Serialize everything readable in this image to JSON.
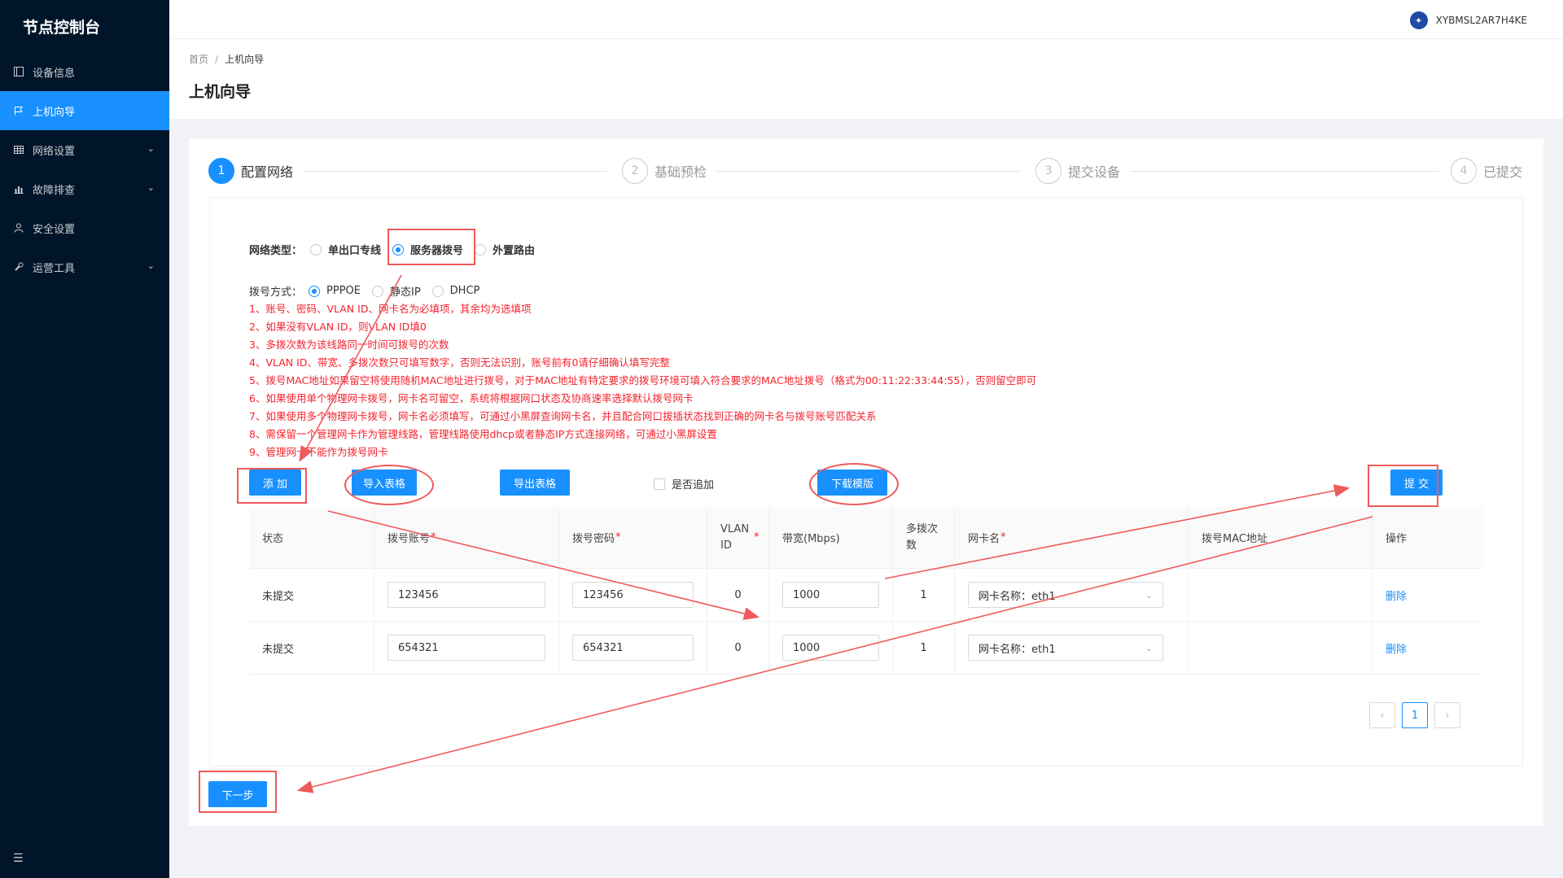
{
  "app": {
    "title": "节点控制台"
  },
  "sidebar": {
    "items": [
      {
        "label": "设备信息",
        "icon": "device-icon",
        "active": false,
        "expandable": false
      },
      {
        "label": "上机向导",
        "icon": "flag-icon",
        "active": true,
        "expandable": false
      },
      {
        "label": "网络设置",
        "icon": "grid-icon",
        "active": false,
        "expandable": true
      },
      {
        "label": "故障排查",
        "icon": "chart-icon",
        "active": false,
        "expandable": true
      },
      {
        "label": "安全设置",
        "icon": "user-icon",
        "active": false,
        "expandable": false
      },
      {
        "label": "运营工具",
        "icon": "tool-icon",
        "active": false,
        "expandable": true
      }
    ]
  },
  "header": {
    "username": "XYBMSL2AR7H4KE"
  },
  "breadcrumb": {
    "home": "首页",
    "sep": "/",
    "current": "上机向导"
  },
  "page": {
    "title": "上机向导"
  },
  "steps": [
    {
      "num": "1",
      "label": "配置网络",
      "active": true
    },
    {
      "num": "2",
      "label": "基础预检",
      "active": false
    },
    {
      "num": "3",
      "label": "提交设备",
      "active": false
    },
    {
      "num": "4",
      "label": "已提交",
      "active": false
    }
  ],
  "form": {
    "network_type_label": "网络类型：",
    "network_types": [
      "单出口专线",
      "服务器拨号",
      "外置路由"
    ],
    "network_type_selected": "服务器拨号",
    "dial_label": "拨号方式：",
    "dial_methods": [
      "PPPOE",
      "静态IP",
      "DHCP"
    ],
    "dial_selected": "PPPOE"
  },
  "notes": [
    "1、账号、密码、VLAN ID、网卡名为必填项，其余均为选填项",
    "2、如果没有VLAN ID，则VLAN ID填0",
    "3、多拨次数为该线路同一时间可拨号的次数",
    "4、VLAN ID、带宽、多拨次数只可填写数字，否则无法识别，账号前有0请仔细确认填写完整",
    "5、拨号MAC地址如果留空将使用随机MAC地址进行拨号，对于MAC地址有特定要求的拨号环境可填入符合要求的MAC地址拨号（格式为00:11:22:33:44:55），否则留空即可",
    "6、如果使用单个物理网卡拨号，网卡名可留空，系统将根据网口状态及协商速率选择默认拨号网卡",
    "7、如果使用多个物理网卡拨号，网卡名必须填写，可通过小黑屏查询网卡名，并且配合网口拔插状态找到正确的网卡名与拨号账号匹配关系",
    "8、需保留一个管理网卡作为管理线路，管理线路使用dhcp或者静态IP方式连接网络，可通过小黑屏设置",
    "9、管理网卡不能作为拨号网卡"
  ],
  "toolbar": {
    "add": "添 加",
    "import": "导入表格",
    "export": "导出表格",
    "append": "是否追加",
    "download": "下载模版",
    "submit": "提 交"
  },
  "table": {
    "headers": [
      "状态",
      "拨号账号",
      "拨号密码",
      "VLAN ID",
      "带宽(Mbps)",
      "多拨次数",
      "网卡名",
      "拨号MAC地址",
      "操作"
    ],
    "rows": [
      {
        "status": "未提交",
        "account": "123456",
        "password": "123456",
        "vlan": "0",
        "bandwidth": "1000",
        "multi": "1",
        "nic": "网卡名称：eth1",
        "mac": "",
        "action": "删除"
      },
      {
        "status": "未提交",
        "account": "654321",
        "password": "654321",
        "vlan": "0",
        "bandwidth": "1000",
        "multi": "1",
        "nic": "网卡名称：eth1",
        "mac": "",
        "action": "删除"
      }
    ]
  },
  "pagination": {
    "prev": "‹",
    "current": "1",
    "next": "›"
  },
  "next_button": "下一步",
  "colors": {
    "primary": "#1890ff",
    "sidebar": "#001529",
    "annotation": "#ef5a5a",
    "note": "#f5222d"
  }
}
